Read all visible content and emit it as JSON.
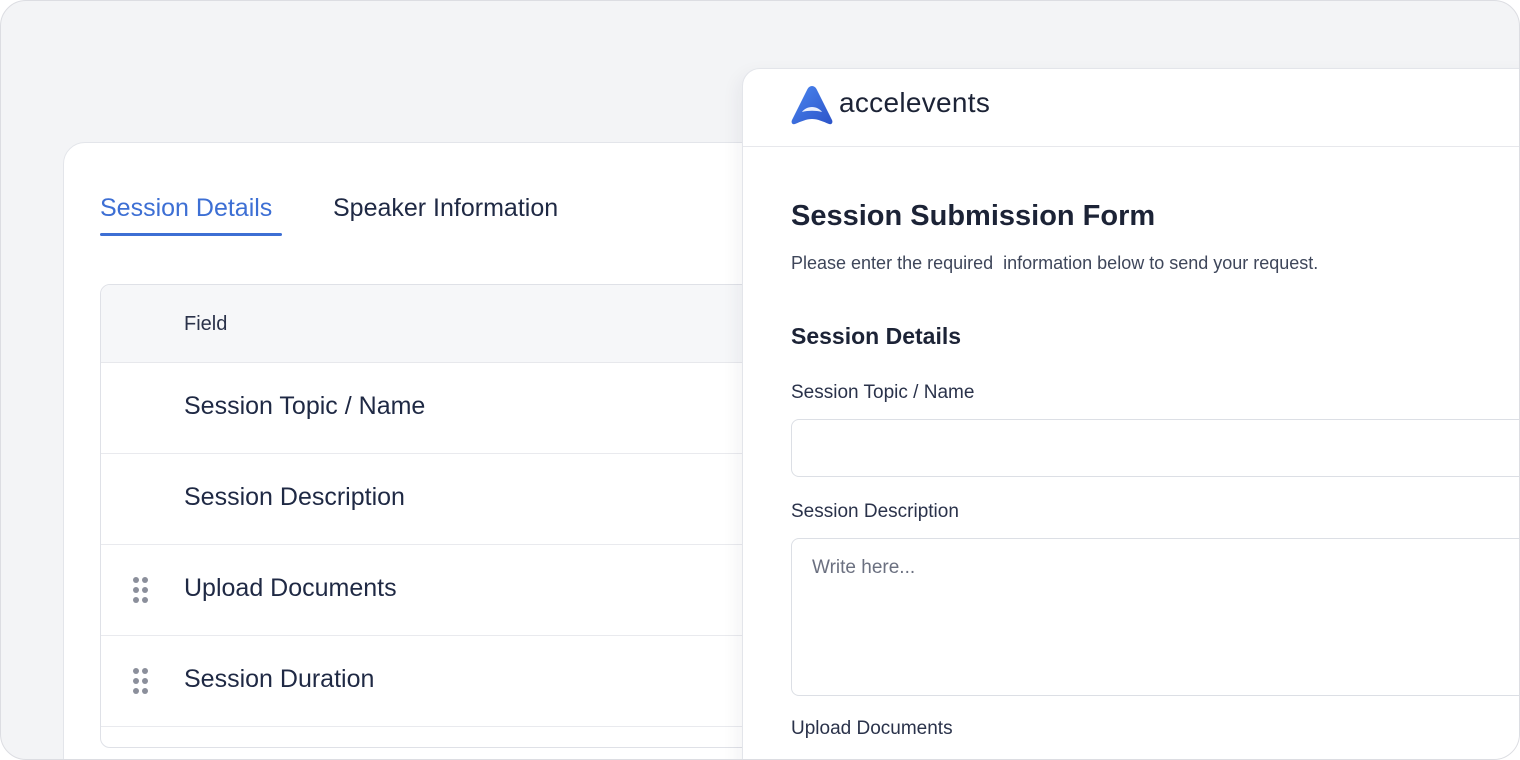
{
  "settings_panel": {
    "tabs": [
      {
        "label": "Session Details"
      },
      {
        "label": "Speaker Information"
      }
    ],
    "table": {
      "column_header": "Field",
      "rows": [
        {
          "label": "Session Topic / Name",
          "draggable": false
        },
        {
          "label": "Session Description",
          "draggable": false
        },
        {
          "label": "Upload Documents",
          "draggable": true
        },
        {
          "label": "Session Duration",
          "draggable": true
        }
      ]
    }
  },
  "form_preview": {
    "brand": "accelevents",
    "title": "Session Submission Form",
    "subtitle": "Please enter the required  information below to send your request.",
    "section_title": "Session Details",
    "fields": [
      {
        "label": "Session Topic / Name",
        "value": "",
        "placeholder": ""
      },
      {
        "label": "Session Description",
        "value": "",
        "placeholder": "Write here..."
      },
      {
        "label": "Upload Documents"
      }
    ]
  },
  "colors": {
    "accent": "#3d6fd4",
    "text_dark": "#1f2944",
    "background": "#f3f4f6"
  },
  "icons": [
    "drag-handle-icon",
    "accelevents-logo-icon"
  ]
}
